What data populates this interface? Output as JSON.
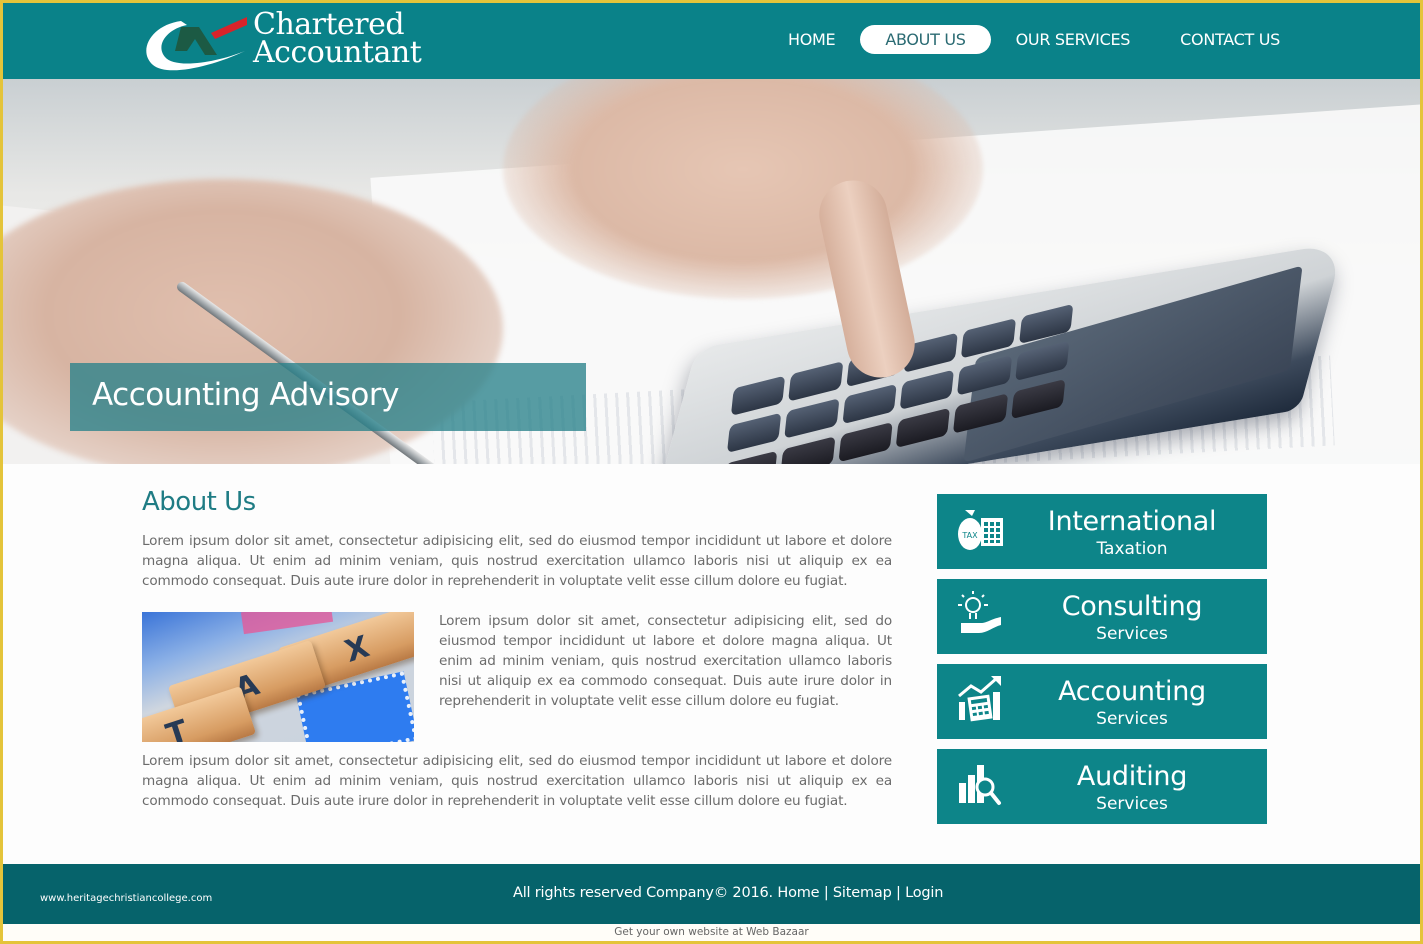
{
  "header": {
    "logo": {
      "mark_label": "CA",
      "line1": "Chartered",
      "line2": "Accountant"
    },
    "nav": [
      {
        "label": "HOME",
        "active": false
      },
      {
        "label": "ABOUT US",
        "active": true
      },
      {
        "label": "OUR SERVICES",
        "active": false
      },
      {
        "label": "CONTACT US",
        "active": false
      }
    ]
  },
  "hero": {
    "caption": "Accounting Advisory",
    "image": "hand-with-pen-and-calculator"
  },
  "about": {
    "title": "About Us",
    "paragraph1": "Lorem ipsum dolor sit amet, consectetur adipisicing elit, sed do eiusmod tempor incididunt ut labore et dolore magna aliqua. Ut enim ad minim veniam, quis nostrud exercitation ullamco laboris nisi ut aliquip ex ea commodo consequat. Duis aute irure dolor in reprehenderit in voluptate velit esse cillum dolore eu fugiat.",
    "image": {
      "subject": "tax-letter-tiles",
      "tiles": [
        "T",
        "A",
        "X"
      ]
    },
    "paragraph2": "Lorem ipsum dolor sit amet, consectetur adipisicing elit, sed do eiusmod tempor incididunt ut labore et dolore magna aliqua. Ut enim ad minim veniam, quis nostrud exercitation ullamco laboris nisi ut aliquip ex ea commodo consequat. Duis aute irure dolor in reprehenderit in voluptate velit esse cillum dolore eu fugiat.",
    "paragraph3": "Lorem ipsum dolor sit amet, consectetur adipisicing elit, sed do eiusmod tempor incididunt ut labore et dolore magna aliqua. Ut enim ad minim veniam, quis nostrud exercitation ullamco laboris nisi ut aliquip ex ea commodo consequat. Duis aute irure dolor in reprehenderit in voluptate velit esse cillum dolore eu fugiat."
  },
  "services": [
    {
      "title": "International",
      "subtitle": "Taxation",
      "icon": "tax-bag-calculator-icon",
      "icon_badge": "TAX"
    },
    {
      "title": "Consulting",
      "subtitle": "Services",
      "icon": "lightbulb-hand-icon"
    },
    {
      "title": "Accounting",
      "subtitle": "Services",
      "icon": "chart-calculator-icon"
    },
    {
      "title": "Auditing",
      "subtitle": "Services",
      "icon": "bar-chart-magnifier-icon"
    }
  ],
  "footer": {
    "watermark": "www.heritagechristiancollege.com",
    "copyright": "All rights reserved Company© 2016.",
    "links": [
      "Home",
      "Sitemap",
      "Login"
    ],
    "separator": "|",
    "below_text": "Get your own website at Web Bazaar"
  },
  "colors": {
    "brand_teal": "#0a8289",
    "footer_teal": "#06636b",
    "service_teal": "#0d8589",
    "heading_teal": "#1f7c84",
    "frame_gold": "#e4c43a",
    "logo_red": "#d8232a",
    "logo_green": "#1c5a44"
  }
}
